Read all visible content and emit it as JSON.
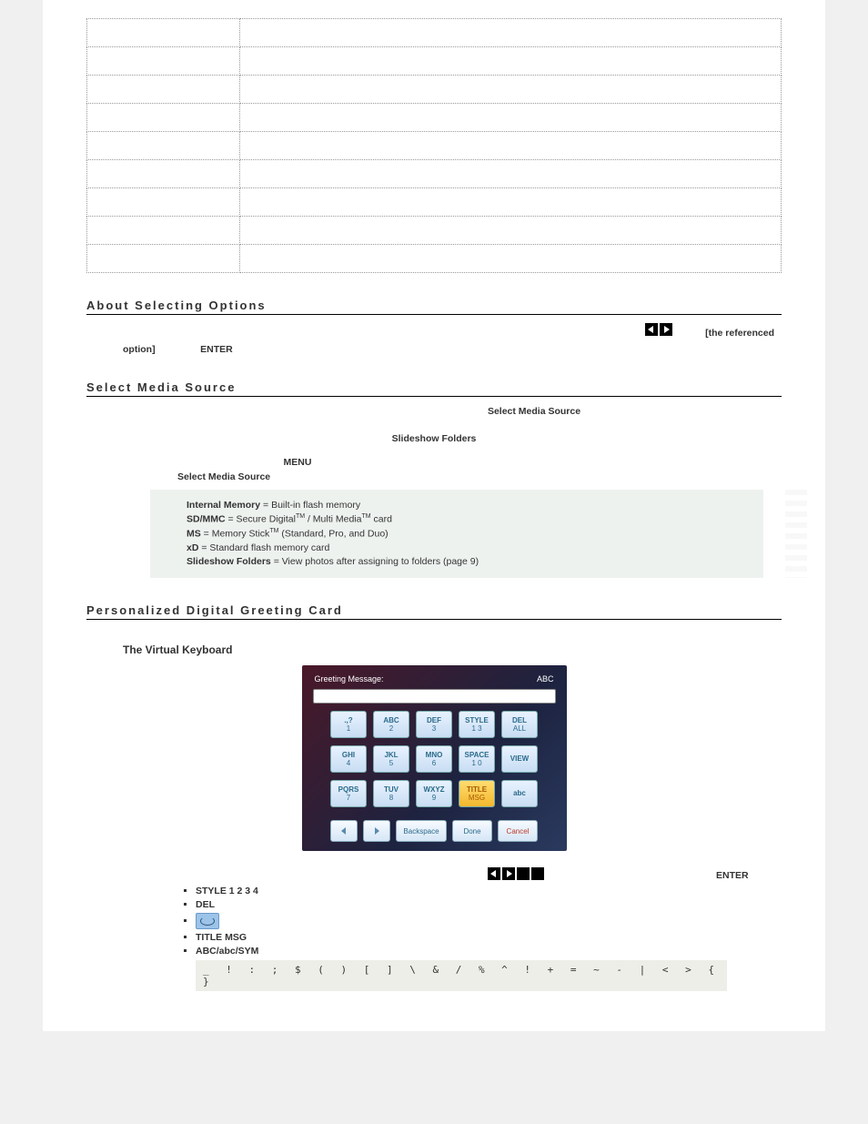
{
  "headings": {
    "about": "About Selecting Options",
    "sms": "Select Media Source",
    "pdg": "Personalized Digital Greeting Card"
  },
  "about": {
    "ref": "[the referenced",
    "option": "option]",
    "enter": "ENTER"
  },
  "sms_line": "Select Media Source",
  "sf": "Slideshow Folders",
  "menu": "MENU",
  "sel": "Select Media Source",
  "note": {
    "l1a": "Internal Memory",
    "l1b": " = Built-in flash memory",
    "l2a": "SD/MMC",
    "l2b": " = Secure Digital",
    "l2c": " / Multi Media",
    "l2d": " card",
    "tm": "TM",
    "l3a": "MS",
    "l3b": " = Memory Stick",
    "l3c": " (Standard, Pro, and Duo)",
    "l4a": "xD",
    "l4b": " = Standard flash memory card",
    "l5a": "Slideshow Folders",
    "l5b": " = View photos after assigning to folders (page 9)"
  },
  "vk": {
    "head": "The Virtual Keyboard",
    "gm": "Greeting Message:",
    "abc": "ABC",
    "keys": [
      [
        [
          ".,?",
          "1"
        ],
        [
          "ABC",
          "2"
        ],
        [
          "DEF",
          "3"
        ],
        [
          "STYLE",
          "1  3"
        ],
        [
          "DEL",
          "ALL"
        ]
      ],
      [
        [
          "GHI",
          "4"
        ],
        [
          "JKL",
          "5"
        ],
        [
          "MNO",
          "6"
        ],
        [
          "SPACE",
          "1 0"
        ],
        [
          "VIEW",
          ""
        ]
      ],
      [
        [
          "PQRS",
          "7"
        ],
        [
          "TUV",
          "8"
        ],
        [
          "WXYZ",
          "9"
        ],
        [
          "TITLE",
          "MSG"
        ],
        [
          "abc",
          ""
        ]
      ]
    ],
    "bottom": {
      "bs": "Backspace",
      "done": "Done",
      "cancel": "Cancel"
    }
  },
  "bullets": {
    "enter": "ENTER",
    "style": "STYLE 1 2 3 4",
    "del": "DEL",
    "title": "TITLE MSG",
    "abc": "ABC/abc/SYM",
    "sym": "_  !  :  ;  $  (  )  [  ]  \\  &  /  %  ^  !  +  =  ~  -  |  <  >  {  }"
  }
}
